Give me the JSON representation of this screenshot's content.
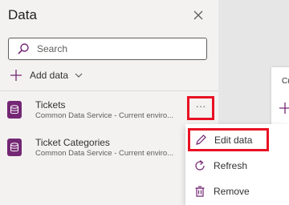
{
  "pane": {
    "title": "Data",
    "search_placeholder": "Search",
    "add_data_label": "Add data"
  },
  "sources": [
    {
      "name": "Tickets",
      "subtitle": "Common Data Service - Current enviro..."
    },
    {
      "name": "Ticket Categories",
      "subtitle": "Common Data Service - Current enviro..."
    }
  ],
  "more_button": {
    "label": "···"
  },
  "context_menu": {
    "items": [
      {
        "label": "Edit data",
        "icon": "pencil-icon"
      },
      {
        "label": "Refresh",
        "icon": "refresh-icon"
      },
      {
        "label": "Remove",
        "icon": "trash-icon"
      }
    ]
  },
  "canvas_card": {
    "label": "Cu"
  },
  "colors": {
    "accent": "#742774",
    "highlight": "#e81123",
    "pane_bg": "#f3f2f1"
  }
}
